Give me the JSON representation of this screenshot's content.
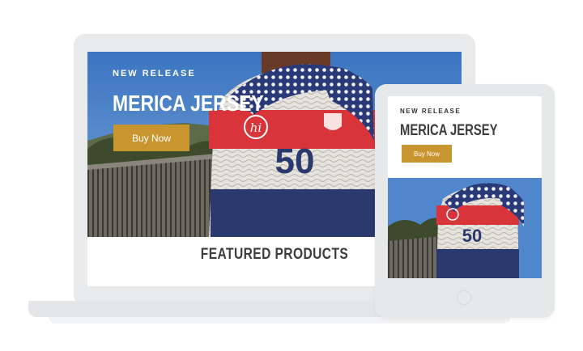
{
  "laptop": {
    "hero": {
      "eyebrow": "NEW RELEASE",
      "headline": "MERICA JERSEY",
      "button_label": "Buy Now"
    },
    "section_title": "FEATURED PRODUCTS"
  },
  "tablet": {
    "eyebrow": "NEW RELEASE",
    "headline": "MERICA JERSEY",
    "button_label": "Buy Now"
  },
  "jersey": {
    "logo_text": "hi",
    "number": "50"
  },
  "colors": {
    "accent": "#c8952e",
    "sky": "#3f78c2",
    "jersey_red": "#d8343a",
    "jersey_navy": "#2b3a6e",
    "device_frame": "#e9eaec"
  }
}
